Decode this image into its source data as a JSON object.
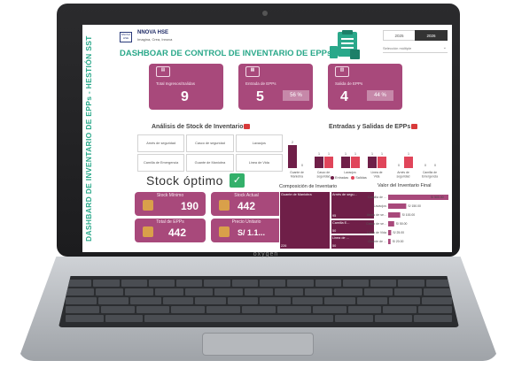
{
  "laptop": {
    "brand": "oxygen"
  },
  "dashboard": {
    "side_title": "DASHBARD DE INVENTARIO DE EPPs - HESTIÓN SST",
    "company": {
      "logo_text": "NNOVA HSE",
      "name": "NNOVA HSE",
      "tagline": "Imagina, Crea, Innova"
    },
    "title": "DASHBOAR DE CONTROL DE INVENTARIO DE EPPs",
    "years": [
      "2025",
      "2026"
    ],
    "selected_year": "2026",
    "select": {
      "value": "Selección múltiple"
    },
    "kpis": [
      {
        "label": "Total Ingresos/Salidas",
        "value": "9"
      },
      {
        "label": "Entrada de EPPs",
        "value": "5",
        "pct": "56 %"
      },
      {
        "label": "Salida de EPPs",
        "value": "4",
        "pct": "44 %"
      }
    ],
    "stock_section": {
      "title": "Análisis de Stock de Inventario",
      "cells": [
        "Arnés de seguridad",
        "Casco de seguridad",
        "Lavaojos",
        "Camilla de Emergencia",
        "Guante de Maniobra",
        "Linea de Vida"
      ],
      "status": "Stock óptimo"
    },
    "mini_kpis": [
      {
        "label": "Stock Mínimo",
        "value": "190"
      },
      {
        "label": "Stock Actual",
        "value": "442"
      },
      {
        "label": "Total de EPPs",
        "value": "442"
      },
      {
        "label": "Precio Unitario",
        "value": "S/ 1.1..."
      }
    ],
    "io_section": {
      "title": "Entradas y Salidas de EPPs"
    },
    "composition_title": "Composición de Inventario",
    "value_title": "Valor del Inventario Final"
  },
  "colors": {
    "accent": "#2aa88a",
    "kpi": "#a8497b",
    "dark_bar": "#6f1f48",
    "entradas": "#6f1f48",
    "salidas": "#e0455a"
  },
  "chart_data": [
    {
      "type": "bar",
      "title": "Entradas y Salidas de EPPs",
      "categories": [
        "Guante de Maniobra",
        "Casco de seguridad",
        "Lavaojos",
        "Linea de Vida",
        "Arnés de seguridad",
        "Camilla de Emergencia"
      ],
      "series": [
        {
          "name": "Entradas",
          "values": [
            2,
            1,
            1,
            1,
            0,
            0
          ]
        },
        {
          "name": "Salidas",
          "values": [
            0,
            1,
            1,
            1,
            1,
            0
          ]
        }
      ],
      "ylim": [
        0,
        2
      ],
      "legend": "bottom"
    },
    {
      "type": "treemap",
      "title": "Composición de Inventario",
      "items": [
        {
          "label": "Guante de Maniobra",
          "value": 226
        },
        {
          "label": "Arnés de segu...",
          "value": 95
        },
        {
          "label": "Camilla E...",
          "value": 50
        },
        {
          "label": "Linea de ...",
          "value": 50
        }
      ],
      "value_labels": [
        "226",
        "95",
        "50",
        "50"
      ]
    },
    {
      "type": "bar",
      "orientation": "horizontal",
      "title": "Valor del Inventario Final",
      "categories": [
        "Camilla de ...",
        "Lavaojos",
        "Arnés de se...",
        "Casco de se...",
        "Linea de Vida",
        "Guante de ..."
      ],
      "values": [
        500,
        150,
        100,
        50,
        25,
        20
      ],
      "value_labels": [
        "S/ 500.00",
        "S/ 150.00",
        "S/ 100.00",
        "S/ 50.00",
        "S/ 25.00",
        "S/ 20.00"
      ]
    }
  ]
}
